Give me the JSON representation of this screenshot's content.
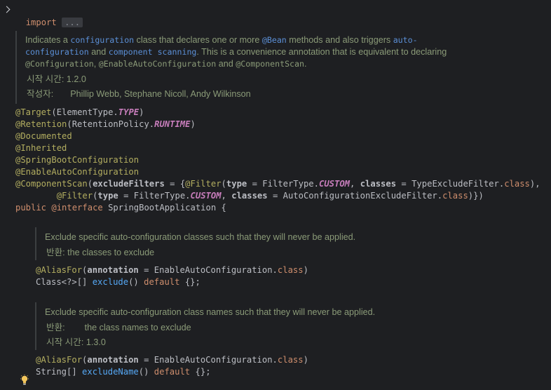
{
  "import_line": {
    "keyword": "import",
    "folded": "..."
  },
  "class_doc": {
    "p1": "Indicates a ",
    "link1": "configuration",
    "p2": " class that declares one or more ",
    "link2": "@Bean",
    "p3": " methods and also triggers ",
    "link3a": "auto-",
    "link3b": "configuration",
    "p4": " and ",
    "link4": "component scanning",
    "p5": ". This is a convenience annotation that is equivalent to declaring",
    "code1": "@Configuration",
    "sep1": ", ",
    "code2": "@EnableAutoConfiguration",
    "p6": " and ",
    "code3": "@ComponentScan",
    "p7": ".",
    "since_label": "시작 시간:",
    "since_value": "1.2.0",
    "author_label": "작성자:",
    "author_value": "Phillip Webb, Stephane Nicoll, Andy Wilkinson"
  },
  "code": {
    "target": "@Target",
    "target_arg_cls": "ElementType.",
    "target_arg_const": "TYPE",
    "retention": "@Retention",
    "retention_arg_cls": "RetentionPolicy.",
    "retention_arg_const": "RUNTIME",
    "documented": "@Documented",
    "inherited": "@Inherited",
    "sbc": "@SpringBootConfiguration",
    "eac": "@EnableAutoConfiguration",
    "cs": "@ComponentScan",
    "cs_param": "excludeFilters",
    "filter": "@Filter",
    "type_param": "type",
    "filtertype": "FilterType.",
    "custom": "CUSTOM",
    "classes_param": "classes",
    "tef": "TypeExcludeFilter",
    "acef": "AutoConfigurationExcludeFilter",
    "class_kw": "class",
    "public_kw": "public",
    "interface_kw": "@interface",
    "app_name": "SpringBootApplication"
  },
  "exclude_doc": {
    "text": "Exclude specific auto-configuration classes such that they will never be applied.",
    "return_label": "반환:",
    "return_value": "the classes to exclude"
  },
  "exclude_method": {
    "aliasfor": "@AliasFor",
    "param": "annotation",
    "cls": "EnableAutoConfiguration",
    "class_kw": "class",
    "type": "Class<?>[]",
    "name": "exclude",
    "default_kw": "default",
    "default_val": "{}"
  },
  "exclude_name_doc": {
    "text": "Exclude specific auto-configuration class names such that they will never be applied.",
    "return_label": "반환:",
    "return_value": "the class names to exclude",
    "since_label": "시작 시간:",
    "since_value": "1.3.0"
  },
  "exclude_name_method": {
    "aliasfor": "@AliasFor",
    "param": "annotation",
    "cls": "EnableAutoConfiguration",
    "class_kw": "class",
    "type": "String[]",
    "name": "excludeName",
    "default_kw": "default",
    "default_val": "{}"
  },
  "icons": {
    "fold": "chevron-right-icon",
    "bulb": "lightbulb-icon"
  },
  "colors": {
    "background": "#1e1f22",
    "keyword": "#cf8e6d",
    "annotation": "#b3ae60",
    "doc_text": "#8b9b78",
    "link": "#5b8fd6",
    "constant": "#c77dbb"
  }
}
